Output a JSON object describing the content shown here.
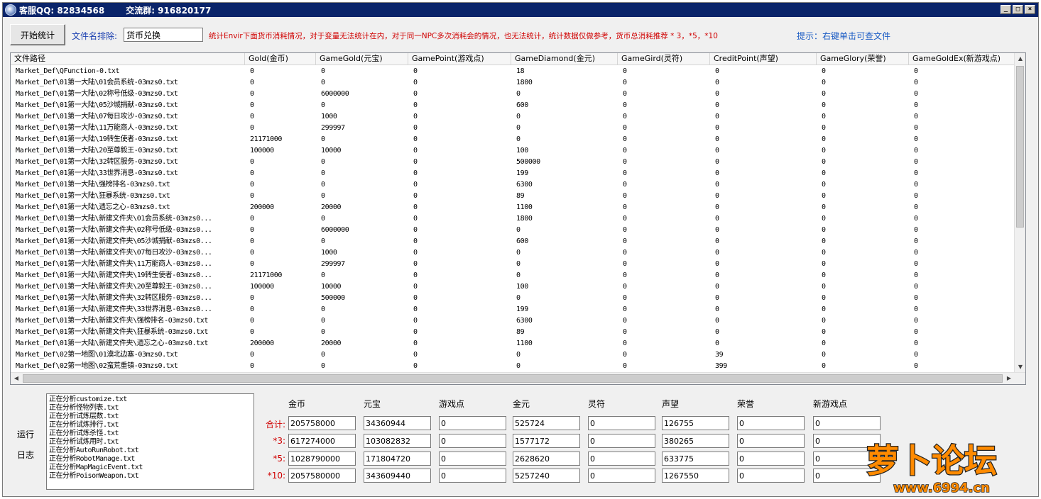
{
  "window": {
    "title_qq": "客服QQ: 82834568",
    "title_group": "交流群: 916820177",
    "btn_min": "_",
    "btn_max": "□",
    "btn_close": "×"
  },
  "toolbar": {
    "start_label": "开始统计",
    "exclude_label": "文件名排除:",
    "exclude_value": "货币兑换",
    "notice": "统计Envir下面货币消耗情况，对于变量无法统计在内，对于同一NPC多次消耗会的情况，也无法统计，统计数据仅做参考，货币总消耗推荐 * 3，*5，*10",
    "hint": "提示：右键单击可查文件"
  },
  "table": {
    "columns": [
      "文件路径",
      "Gold(金币)",
      "GameGold(元宝)",
      "GamePoint(游戏点)",
      "GameDiamond(金元)",
      "GameGird(灵符)",
      "CreditPoint(声望)",
      "GameGlory(荣誉)",
      "GameGoldEx(新游戏点)"
    ],
    "rows": [
      [
        "Market_Def\\QFunction-0.txt",
        "0",
        "0",
        "0",
        "18",
        "0",
        "0",
        "0",
        "0"
      ],
      [
        "Market_Def\\01第一大陆\\01会员系统-03mzs0.txt",
        "0",
        "0",
        "0",
        "1800",
        "0",
        "0",
        "0",
        "0"
      ],
      [
        "Market_Def\\01第一大陆\\02称号低级-03mzs0.txt",
        "0",
        "6000000",
        "0",
        "0",
        "0",
        "0",
        "0",
        "0"
      ],
      [
        "Market_Def\\01第一大陆\\05沙城捐献-03mzs0.txt",
        "0",
        "0",
        "0",
        "600",
        "0",
        "0",
        "0",
        "0"
      ],
      [
        "Market_Def\\01第一大陆\\07每日攻沙-03mzs0.txt",
        "0",
        "1000",
        "0",
        "0",
        "0",
        "0",
        "0",
        "0"
      ],
      [
        "Market_Def\\01第一大陆\\11万能商人-03mzs0.txt",
        "0",
        "299997",
        "0",
        "0",
        "0",
        "0",
        "0",
        "0"
      ],
      [
        "Market_Def\\01第一大陆\\19转生使者-03mzs0.txt",
        "21171000",
        "0",
        "0",
        "0",
        "0",
        "0",
        "0",
        "0"
      ],
      [
        "Market_Def\\01第一大陆\\20至尊毅王-03mzs0.txt",
        "100000",
        "10000",
        "0",
        "100",
        "0",
        "0",
        "0",
        "0"
      ],
      [
        "Market_Def\\01第一大陆\\32转区服务-03mzs0.txt",
        "0",
        "0",
        "0",
        "500000",
        "0",
        "0",
        "0",
        "0"
      ],
      [
        "Market_Def\\01第一大陆\\33世界消息-03mzs0.txt",
        "0",
        "0",
        "0",
        "199",
        "0",
        "0",
        "0",
        "0"
      ],
      [
        "Market_Def\\01第一大陆\\强榜排名-03mzs0.txt",
        "0",
        "0",
        "0",
        "6300",
        "0",
        "0",
        "0",
        "0"
      ],
      [
        "Market_Def\\01第一大陆\\狂暴系统-03mzs0.txt",
        "0",
        "0",
        "0",
        "89",
        "0",
        "0",
        "0",
        "0"
      ],
      [
        "Market_Def\\01第一大陆\\遗忘之心-03mzs0.txt",
        "200000",
        "20000",
        "0",
        "1100",
        "0",
        "0",
        "0",
        "0"
      ],
      [
        "Market_Def\\01第一大陆\\新建文件夹\\01会员系统-03mzs0...",
        "0",
        "0",
        "0",
        "1800",
        "0",
        "0",
        "0",
        "0"
      ],
      [
        "Market_Def\\01第一大陆\\新建文件夹\\02称号低级-03mzs0...",
        "0",
        "6000000",
        "0",
        "0",
        "0",
        "0",
        "0",
        "0"
      ],
      [
        "Market_Def\\01第一大陆\\新建文件夹\\05沙城捐献-03mzs0...",
        "0",
        "0",
        "0",
        "600",
        "0",
        "0",
        "0",
        "0"
      ],
      [
        "Market_Def\\01第一大陆\\新建文件夹\\07每日攻沙-03mzs0...",
        "0",
        "1000",
        "0",
        "0",
        "0",
        "0",
        "0",
        "0"
      ],
      [
        "Market_Def\\01第一大陆\\新建文件夹\\11万能商人-03mzs0...",
        "0",
        "299997",
        "0",
        "0",
        "0",
        "0",
        "0",
        "0"
      ],
      [
        "Market_Def\\01第一大陆\\新建文件夹\\19转生使者-03mzs0...",
        "21171000",
        "0",
        "0",
        "0",
        "0",
        "0",
        "0",
        "0"
      ],
      [
        "Market_Def\\01第一大陆\\新建文件夹\\20至尊毅王-03mzs0...",
        "100000",
        "10000",
        "0",
        "100",
        "0",
        "0",
        "0",
        "0"
      ],
      [
        "Market_Def\\01第一大陆\\新建文件夹\\32转区服务-03mzs0...",
        "0",
        "500000",
        "0",
        "0",
        "0",
        "0",
        "0",
        "0"
      ],
      [
        "Market_Def\\01第一大陆\\新建文件夹\\33世界消息-03mzs0...",
        "0",
        "0",
        "0",
        "199",
        "0",
        "0",
        "0",
        "0"
      ],
      [
        "Market_Def\\01第一大陆\\新建文件夹\\强榜排名-03mzs0.txt",
        "0",
        "0",
        "0",
        "6300",
        "0",
        "0",
        "0",
        "0"
      ],
      [
        "Market_Def\\01第一大陆\\新建文件夹\\狂暴系统-03mzs0.txt",
        "0",
        "0",
        "0",
        "89",
        "0",
        "0",
        "0",
        "0"
      ],
      [
        "Market_Def\\01第一大陆\\新建文件夹\\遗忘之心-03mzs0.txt",
        "200000",
        "20000",
        "0",
        "1100",
        "0",
        "0",
        "0",
        "0"
      ],
      [
        "Market_Def\\02第一地图\\01漠北边塞-03mzs0.txt",
        "0",
        "0",
        "0",
        "0",
        "0",
        "39",
        "0",
        "0"
      ],
      [
        "Market_Def\\02第一地图\\02蛮荒重镇-03mzs0.txt",
        "0",
        "0",
        "0",
        "0",
        "0",
        "399",
        "0",
        "0"
      ]
    ]
  },
  "log": {
    "label_top": "运行",
    "label_bottom": "日志",
    "lines": [
      "正在分析customize.txt",
      "正在分析怪物列表.txt",
      "正在分析试炼层数.txt",
      "正在分析试炼排行.txt",
      "正在分析试炼杀怪.txt",
      "正在分析试炼用时.txt",
      "正在分析AutoRunRobot.txt",
      "正在分析RobotManage.txt",
      "正在分析MapMagicEvent.txt",
      "正在分析PoisonWeapon.txt"
    ]
  },
  "stats": {
    "headers": [
      "金币",
      "元宝",
      "游戏点",
      "金元",
      "灵符",
      "声望",
      "荣誉",
      "新游戏点"
    ],
    "rows": [
      {
        "label": "合计:",
        "values": [
          "205758000",
          "34360944",
          "0",
          "525724",
          "0",
          "126755",
          "0",
          "0"
        ]
      },
      {
        "label": "*3:",
        "values": [
          "617274000",
          "103082832",
          "0",
          "1577172",
          "0",
          "380265",
          "0",
          "0"
        ]
      },
      {
        "label": "*5:",
        "values": [
          "1028790000",
          "171804720",
          "0",
          "2628620",
          "0",
          "633775",
          "0",
          "0"
        ]
      },
      {
        "label": "*10:",
        "values": [
          "2057580000",
          "343609440",
          "0",
          "5257240",
          "0",
          "1267550",
          "0",
          "0"
        ]
      }
    ]
  },
  "watermark": {
    "logo_text": "萝卜论坛",
    "url": "www.6994.cn"
  }
}
